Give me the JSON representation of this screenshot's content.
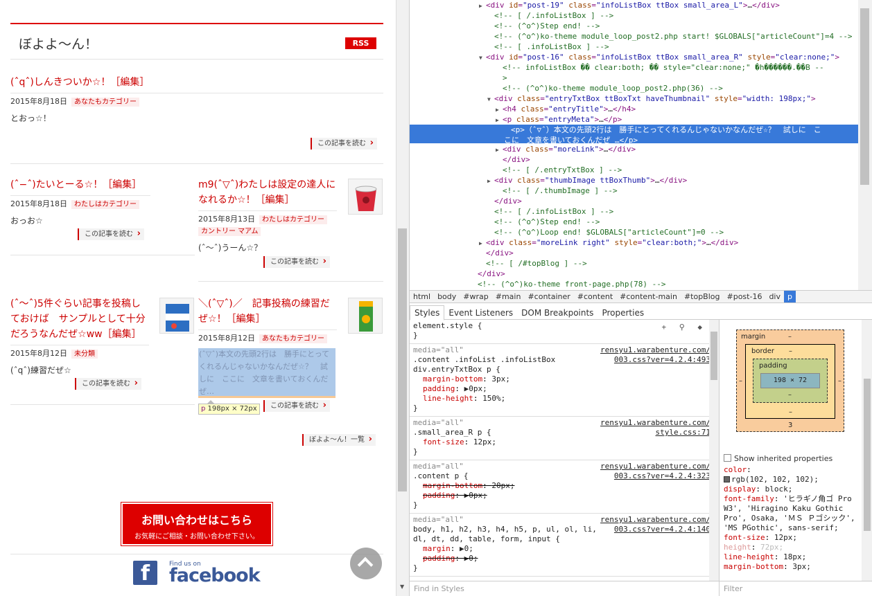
{
  "blog": {
    "title": "ぼよよ〜ん！",
    "rss": "RSS",
    "read_more": "この記事を読む",
    "archive_link": "ぼよよ〜ん！一覧",
    "edit": "編集",
    "posts": [
      {
        "title": "(ˆqˆ)しんきついか☆！",
        "date": "2015年8月18日",
        "category": "あなたもカテゴリー",
        "body": "とおっ☆！"
      },
      {
        "title": "(ˆ−ˆ)たいとーる☆！",
        "date": "2015年8月18日",
        "category": "わたしはカテゴリー",
        "body": "おっお☆"
      },
      {
        "title": "m9(ˆ▽ˆ)わたしは設定の達人になれるか☆！",
        "date": "2015年8月13日",
        "category": "わたしはカテゴリー",
        "category2": "カントリー マアム",
        "body": "(ˆ〜ˆ)うーん☆？"
      },
      {
        "title": "(ˆ〜ˆ)5件ぐらい記事を投稿しておけば　サンプルとして十分だろうなんだぜ☆ww",
        "date": "2015年8月12日",
        "category": "未分類",
        "body": "(ˆqˆ)練習だぜ☆"
      },
      {
        "title": "＼(ˆ▽ˆ)／　記事投稿の練習だぜ☆！",
        "date": "2015年8月12日",
        "category": "あなたもカテゴリー",
        "body": "(ˆ▽ˆ)本文の先頭2行は　勝手にとってくれるんじゃないかなんだぜ☆？　試しに　ここに　文章を書いておくんだぜ…"
      }
    ],
    "tooltip": {
      "tag": "p",
      "size": "198px × 72px"
    },
    "contact": {
      "main": "お問い合わせはこちら",
      "sub": "お気軽にご相談・お問い合わせ下さい。"
    },
    "facebook": {
      "find": "Find us on",
      "name": "facebook",
      "logo": "f"
    }
  },
  "devtools": {
    "dom_lines": [
      {
        "indent": 8,
        "tri": "▶",
        "html": "<span class='tg'>&lt;div</span> <span class='an'>id</span>=<span class='av'>\"post-19\"</span> <span class='an'>class</span>=<span class='av'>\"infoListBox ttBox small_area_L\"</span><span class='tg'>&gt;</span><span class='tx'>…</span><span class='tg'>&lt;/div&gt;</span>"
      },
      {
        "indent": 9,
        "tri": "",
        "html": "<span class='cm'>&lt;!-- [ /.infoListBox ] --&gt;</span>"
      },
      {
        "indent": 9,
        "tri": "",
        "html": "<span class='cm'>&lt;!-- (^o^)Step end! --&gt;</span>"
      },
      {
        "indent": 9,
        "tri": "",
        "html": "<span class='cm'>&lt;!-- (^o^)ko-theme module_loop_post2.php start! $GLOBALS[\"articleCount\"]=4 --&gt;</span>"
      },
      {
        "indent": 9,
        "tri": "",
        "html": "<span class='cm'>&lt;!-- [ .infoListBox ] --&gt;</span>"
      },
      {
        "indent": 8,
        "tri": "▼",
        "html": "<span class='tg'>&lt;div</span> <span class='an'>id</span>=<span class='av'>\"post-16\"</span> <span class='an'>class</span>=<span class='av'>\"infoListBox ttBox small_area_R\"</span> <span class='an'>style</span>=<span class='av'>\"clear:none;\"</span><span class='tg'>&gt;</span>"
      },
      {
        "indent": 10,
        "tri": "",
        "html": "<span class='cm'>&lt;!-- infoListBox �� clear:both; �� style=\"clear:none;\" �h������.��B --</span>"
      },
      {
        "indent": 10,
        "tri": "",
        "html": "<span class='cm'>&gt;</span>"
      },
      {
        "indent": 10,
        "tri": "",
        "html": "<span class='cm'>&lt;!-- (^o^)ko-theme module_loop_post2.php(36) --&gt;</span>"
      },
      {
        "indent": 9,
        "tri": "▼",
        "html": "<span class='tg'>&lt;div</span> <span class='an'>class</span>=<span class='av'>\"entryTxtBox ttBoxTxt haveThumbnail\"</span> <span class='an'>style</span>=<span class='av'>\"width: 198px;\"</span><span class='tg'>&gt;</span>"
      },
      {
        "indent": 10,
        "tri": "▶",
        "html": "<span class='tg'>&lt;h4</span> <span class='an'>class</span>=<span class='av'>\"entryTitle\"</span><span class='tg'>&gt;</span><span class='tx'>…</span><span class='tg'>&lt;/h4&gt;</span>"
      },
      {
        "indent": 10,
        "tri": "▶",
        "html": "<span class='tg'>&lt;p</span> <span class='an'>class</span>=<span class='av'>\"entryMeta\"</span><span class='tg'>&gt;</span><span class='tx'>…</span><span class='tg'>&lt;/p&gt;</span>"
      },
      {
        "indent": 11,
        "tri": "",
        "sel": true,
        "html": "<span>&lt;p&gt;（ˆ▽ˆ）本文の先頭2行は　勝手にとってくれるんじゃないかなんだぜ☆？　試しに　こ</span><br><span>こに　文章を書いておくんだぜ …&lt;/p&gt;</span>"
      },
      {
        "indent": 10,
        "tri": "▶",
        "html": "<span class='tg'>&lt;div</span> <span class='an'>class</span>=<span class='av'>\"moreLink\"</span><span class='tg'>&gt;</span><span class='tx'>…</span><span class='tg'>&lt;/div&gt;</span>"
      },
      {
        "indent": 10,
        "tri": "",
        "html": "<span class='tg'>&lt;/div&gt;</span>"
      },
      {
        "indent": 10,
        "tri": "",
        "html": "<span class='cm'>&lt;!-- [ /.entryTxtBox ] --&gt;</span>"
      },
      {
        "indent": 9,
        "tri": "▶",
        "html": "<span class='tg'>&lt;div</span> <span class='an'>class</span>=<span class='av'>\"thumbImage ttBoxThumb\"</span><span class='tg'>&gt;</span><span class='tx'>…</span><span class='tg'>&lt;/div&gt;</span>"
      },
      {
        "indent": 10,
        "tri": "",
        "html": "<span class='cm'>&lt;!-- [ /.thumbImage ] --&gt;</span>"
      },
      {
        "indent": 9,
        "tri": "",
        "html": "<span class='tg'>&lt;/div&gt;</span>"
      },
      {
        "indent": 9,
        "tri": "",
        "html": "<span class='cm'>&lt;!-- [ /.infoListBox ] --&gt;</span>"
      },
      {
        "indent": 9,
        "tri": "",
        "html": "<span class='cm'>&lt;!-- (^o^)Step end! --&gt;</span>"
      },
      {
        "indent": 9,
        "tri": "",
        "html": "<span class='cm'>&lt;!-- (^o^)Loop end! $GLOBALS[\"articleCount\"]=0 --&gt;</span>"
      },
      {
        "indent": 8,
        "tri": "▶",
        "html": "<span class='tg'>&lt;div</span> <span class='an'>class</span>=<span class='av'>\"moreLink right\"</span> <span class='an'>style</span>=<span class='av'>\"clear:both;\"</span><span class='tg'>&gt;</span><span class='tx'>…</span><span class='tg'>&lt;/div&gt;</span>"
      },
      {
        "indent": 8,
        "tri": "",
        "html": "<span class='tg'>&lt;/div&gt;</span>"
      },
      {
        "indent": 8,
        "tri": "",
        "html": "<span class='cm'>&lt;!-- [ /#topBlog ] --&gt;</span>"
      },
      {
        "indent": 7,
        "tri": "",
        "html": "<span class='tg'>&lt;/div&gt;</span>"
      },
      {
        "indent": 7,
        "tri": "",
        "html": "<span class='cm'>&lt;!-- (^o^)ko-theme front-page.php(78) --&gt;</span>"
      }
    ],
    "breadcrumbs": [
      "html",
      "body",
      "#wrap",
      "#main",
      "#container",
      "#content",
      "#content-main",
      "#topBlog",
      "#post-16",
      "div",
      "p"
    ],
    "tabs": [
      "Styles",
      "Event Listeners",
      "DOM Breakpoints",
      "Properties"
    ],
    "element_style": "element.style {",
    "rules": [
      {
        "media": "media=\"all\"",
        "src": "rensyu1.warabenture.com/\n003.css?ver=4.2.4:493",
        "selector": ".content .infoList .infoListBox\ndiv.entryTxtBox p {",
        "props": [
          [
            "margin-bottom",
            "3px;",
            false
          ],
          [
            "padding",
            "▶0px;",
            false
          ],
          [
            "line-height",
            "150%;",
            false
          ]
        ]
      },
      {
        "media": "media=\"all\"",
        "src": "rensyu1.warabenture.com/\nstyle.css:71",
        "selector": ".small_area_R p {",
        "props": [
          [
            "font-size",
            "12px;",
            false
          ]
        ]
      },
      {
        "media": "media=\"all\"",
        "src": "rensyu1.warabenture.com/\n003.css?ver=4.2.4:323",
        "selector": ".content p {",
        "props": [
          [
            "margin-bottom",
            "20px;",
            true
          ],
          [
            "padding",
            "▶0px;",
            true
          ]
        ]
      },
      {
        "media": "media=\"all\"",
        "src": "rensyu1.warabenture.com/\n003.css?ver=4.2.4:140",
        "selector": "body, h1, h2, h3, h4, h5, p, ul, ol, li,\ndl, dt, dd, table, form, input {",
        "props": [
          [
            "margin",
            "▶0;",
            false
          ],
          [
            "padding",
            "▶0;",
            true
          ]
        ]
      }
    ],
    "box_model": {
      "margin": "margin",
      "border": "border",
      "padding": "padding",
      "content": "198 × 72",
      "dash": "–",
      "bottom_margin": "3"
    },
    "computed": {
      "show_inherited": "Show inherited properties",
      "props": [
        [
          "color",
          "rgb(102, 102, 102);",
          false
        ],
        [
          "display",
          "block;",
          false
        ],
        [
          "font-family",
          "'ヒラギノ角ゴ Pro W3', 'Hiragino Kaku Gothic Pro', Osaka, 'ＭＳ Ｐゴシック', 'MS PGothic', sans-serif;",
          false
        ],
        [
          "font-size",
          "12px;",
          false
        ],
        [
          "height",
          "72px;",
          true
        ],
        [
          "line-height",
          "18px;",
          false
        ],
        [
          "margin-bottom",
          "3px;",
          false
        ]
      ]
    },
    "find_placeholder": "Find in Styles",
    "filter_placeholder": "Filter"
  },
  "colors": {
    "accent": "#dd0000",
    "selection": "#3879d9",
    "fb": "#3b5998"
  }
}
